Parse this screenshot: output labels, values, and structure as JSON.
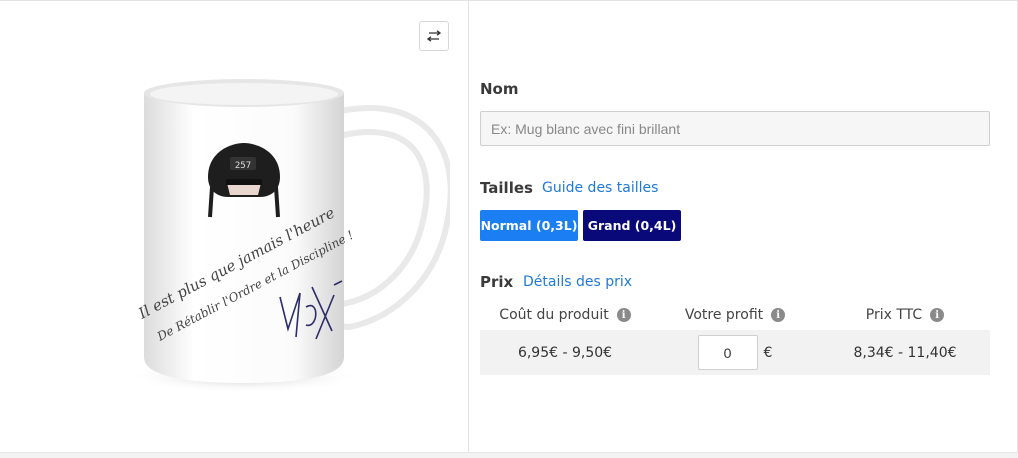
{
  "preview": {
    "mug_text_line1": "Il est plus que jamais l'heure",
    "mug_text_line2": "De Rétablir l'Ordre et la Discipline !",
    "hat_badge": "257"
  },
  "form": {
    "name_label": "Nom",
    "name_placeholder": "Ex: Mug blanc avec fini brillant",
    "name_value": "",
    "sizes_label": "Tailles",
    "sizes_guide_link": "Guide des tailles",
    "sizes": [
      {
        "label": "Normal (0,3L)",
        "color": "#1b7ef2"
      },
      {
        "label": "Grand (0,4L)",
        "color": "#0a097a"
      }
    ],
    "price_label": "Prix",
    "price_details_link": "Détails des prix",
    "price_table": {
      "headers": [
        "Coût du produit",
        "Votre profit",
        "Prix TTC"
      ],
      "product_cost": "6,95€ - 9,50€",
      "profit_value": "0",
      "profit_currency": "€",
      "price_ttc": "8,34€ - 11,40€"
    }
  },
  "icons": {
    "swap": "swap-horizontal-icon",
    "info": "info-icon"
  },
  "colors": {
    "link": "#1f7ad6",
    "size_normal": "#1b7ef2",
    "size_grand": "#0a097a"
  }
}
